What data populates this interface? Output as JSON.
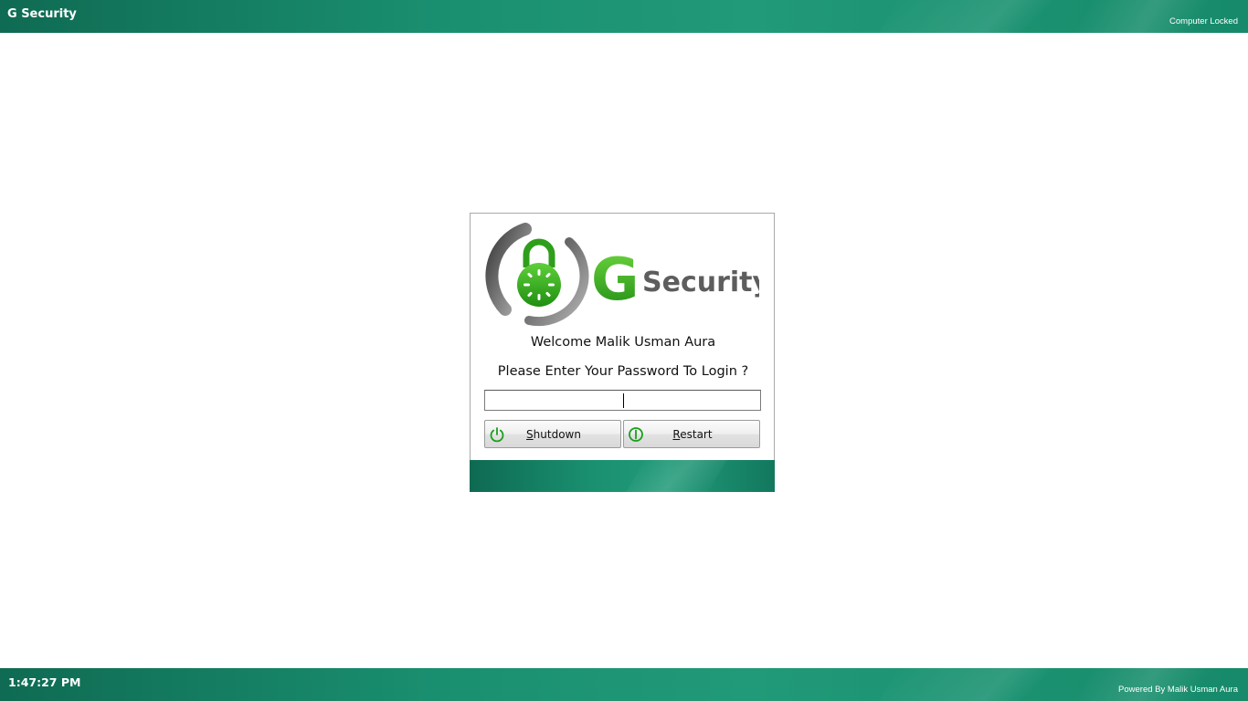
{
  "header": {
    "app_title": "G Security",
    "status": "Computer Locked"
  },
  "login": {
    "logo_letter": "G",
    "logo_text": "Security",
    "welcome": "Welcome Malik Usman Aura",
    "prompt": "Please Enter Your Password To Login ?",
    "password_value": "",
    "shutdown_mnemonic": "S",
    "shutdown_rest": "hutdown",
    "restart_mnemonic": "R",
    "restart_rest": "estart"
  },
  "footer": {
    "clock": "1:47:27 PM",
    "powered_by": "Powered By Malik Usman Aura"
  },
  "colors": {
    "brand_teal": "#1a8f70",
    "logo_green": "#3aa520",
    "logo_gray": "#5a5a5a"
  },
  "icons": {
    "shutdown": "power-icon",
    "restart": "restart-icon",
    "logo": "padlock-logo-icon"
  }
}
